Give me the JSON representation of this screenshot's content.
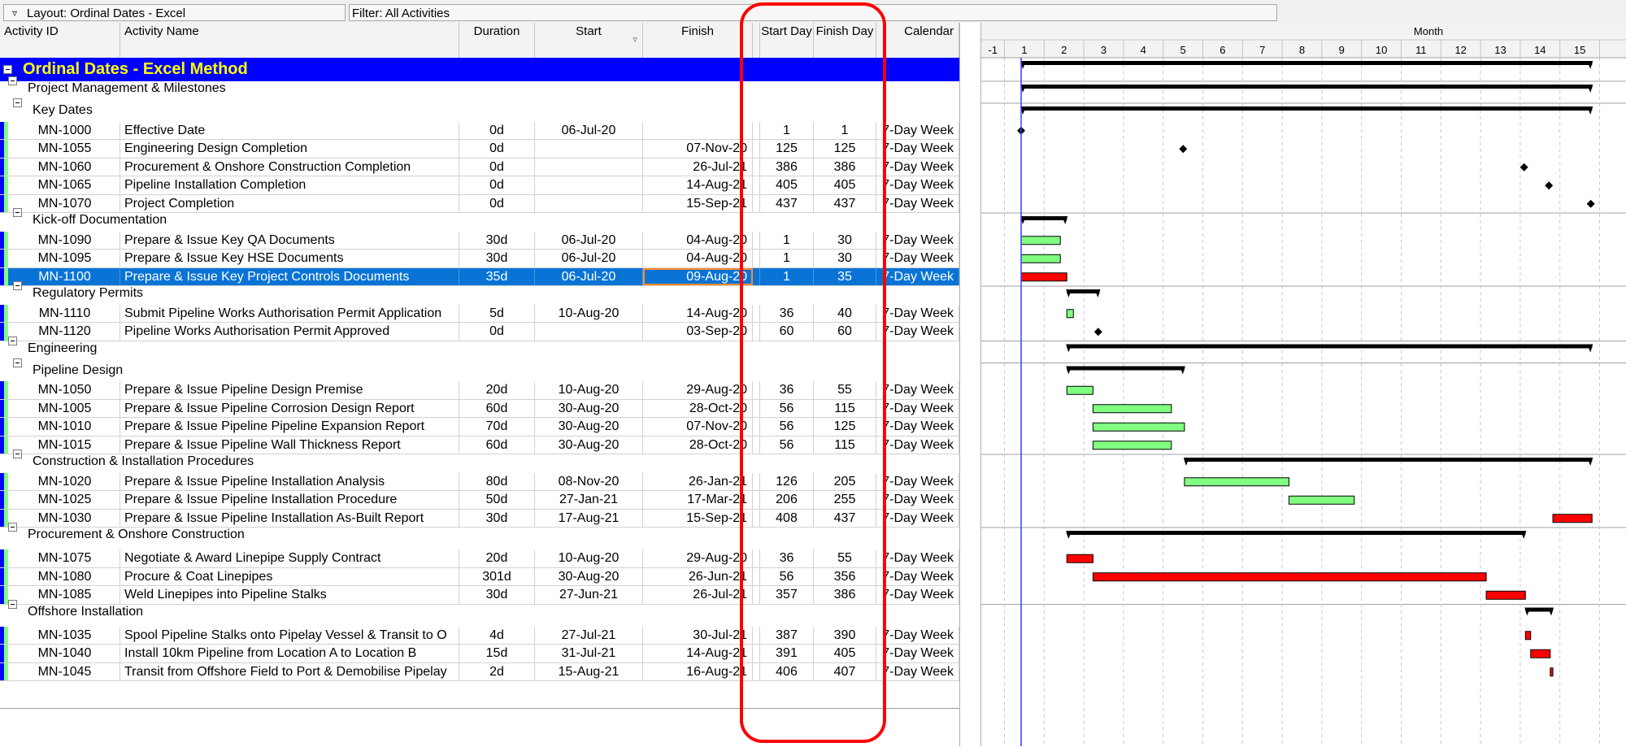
{
  "toolbar": {
    "layout_label": "Layout: Ordinal Dates - Excel",
    "filter_label": "Filter: All Activities"
  },
  "columns": {
    "activity_id": "Activity ID",
    "activity_name": "Activity Name",
    "duration": "Duration",
    "start": "Start",
    "finish": "Finish",
    "start_day": "Start Day",
    "finish_day": "Finish Day",
    "calendar": "Calendar"
  },
  "timescale": {
    "band_label": "Month",
    "months": [
      "-1",
      "1",
      "2",
      "3",
      "4",
      "5",
      "6",
      "7",
      "8",
      "9",
      "10",
      "11",
      "12",
      "13",
      "14",
      "15"
    ]
  },
  "colors": {
    "project_band": "#0000ff",
    "wbs1_band": "#80ff80",
    "wbs2_band": "#ffff00",
    "selected_row": "#0a74d6",
    "bar_normal": "#80ff80",
    "bar_critical": "#ff0000",
    "summary_bar": "#000000",
    "data_date_line": "#3a3aff",
    "callout": "#ff0000"
  },
  "rows": [
    {
      "kind": "project",
      "title": "Ordinal Dates - Excel Method",
      "summary": {
        "from": 1,
        "to": 437
      }
    },
    {
      "kind": "wbs1",
      "title": "Project Management & Milestones",
      "summary": {
        "from": 1,
        "to": 437
      }
    },
    {
      "kind": "wbs2",
      "title": "Key Dates",
      "summary": {
        "from": 1,
        "to": 437
      }
    },
    {
      "kind": "act",
      "id": "MN-1000",
      "name": "Effective Date",
      "duration": "0d",
      "start": "06-Jul-20",
      "finish": "",
      "start_day": "1",
      "finish_day": "1",
      "calendar": "7-Day Week",
      "bar": {
        "type": "milestone",
        "from": 1,
        "to": 1
      }
    },
    {
      "kind": "act",
      "id": "MN-1055",
      "name": "Engineering Design Completion",
      "duration": "0d",
      "start": "",
      "finish": "07-Nov-20",
      "start_day": "125",
      "finish_day": "125",
      "calendar": "7-Day Week",
      "bar": {
        "type": "milestone",
        "from": 125,
        "to": 125
      }
    },
    {
      "kind": "act",
      "id": "MN-1060",
      "name": "Procurement & Onshore Construction Completion",
      "duration": "0d",
      "start": "",
      "finish": "26-Jul-21",
      "start_day": "386",
      "finish_day": "386",
      "calendar": "7-Day Week",
      "bar": {
        "type": "milestone",
        "from": 386,
        "to": 386
      }
    },
    {
      "kind": "act",
      "id": "MN-1065",
      "name": "Pipeline Installation Completion",
      "duration": "0d",
      "start": "",
      "finish": "14-Aug-21",
      "start_day": "405",
      "finish_day": "405",
      "calendar": "7-Day Week",
      "bar": {
        "type": "milestone",
        "from": 405,
        "to": 405
      }
    },
    {
      "kind": "act",
      "id": "MN-1070",
      "name": "Project Completion",
      "duration": "0d",
      "start": "",
      "finish": "15-Sep-21",
      "start_day": "437",
      "finish_day": "437",
      "calendar": "7-Day Week",
      "bar": {
        "type": "milestone",
        "from": 437,
        "to": 437
      }
    },
    {
      "kind": "wbs2",
      "title": "Kick-off Documentation",
      "summary": {
        "from": 1,
        "to": 35
      }
    },
    {
      "kind": "act",
      "id": "MN-1090",
      "name": "Prepare & Issue Key QA Documents",
      "duration": "30d",
      "start": "06-Jul-20",
      "finish": "04-Aug-20",
      "start_day": "1",
      "finish_day": "30",
      "calendar": "7-Day Week",
      "bar": {
        "type": "normal",
        "from": 1,
        "to": 30
      }
    },
    {
      "kind": "act",
      "id": "MN-1095",
      "name": "Prepare & Issue Key HSE Documents",
      "duration": "30d",
      "start": "06-Jul-20",
      "finish": "04-Aug-20",
      "start_day": "1",
      "finish_day": "30",
      "calendar": "7-Day Week",
      "bar": {
        "type": "normal",
        "from": 1,
        "to": 30
      }
    },
    {
      "kind": "act",
      "id": "MN-1100",
      "name": "Prepare & Issue Key Project Controls Documents",
      "duration": "35d",
      "start": "06-Jul-20",
      "finish": "09-Aug-20",
      "start_day": "1",
      "finish_day": "35",
      "calendar": "7-Day Week",
      "selected": true,
      "bar": {
        "type": "critical",
        "from": 1,
        "to": 35
      }
    },
    {
      "kind": "wbs2",
      "title": "Regulatory Permits",
      "summary": {
        "from": 36,
        "to": 60
      }
    },
    {
      "kind": "act",
      "id": "MN-1110",
      "name": "Submit Pipeline Works Authorisation Permit Application",
      "duration": "5d",
      "start": "10-Aug-20",
      "finish": "14-Aug-20",
      "start_day": "36",
      "finish_day": "40",
      "calendar": "7-Day Week",
      "bar": {
        "type": "normal",
        "from": 36,
        "to": 40
      }
    },
    {
      "kind": "act",
      "id": "MN-1120",
      "name": "Pipeline Works Authorisation Permit Approved",
      "duration": "0d",
      "start": "",
      "finish": "03-Sep-20",
      "start_day": "60",
      "finish_day": "60",
      "calendar": "7-Day Week",
      "bar": {
        "type": "milestone",
        "from": 60,
        "to": 60
      }
    },
    {
      "kind": "wbs1",
      "title": "Engineering",
      "summary": {
        "from": 36,
        "to": 437
      }
    },
    {
      "kind": "wbs2",
      "title": "Pipeline Design",
      "summary": {
        "from": 36,
        "to": 125
      }
    },
    {
      "kind": "act",
      "id": "MN-1050",
      "name": "Prepare & Issue Pipeline Design Premise",
      "duration": "20d",
      "start": "10-Aug-20",
      "finish": "29-Aug-20",
      "start_day": "36",
      "finish_day": "55",
      "calendar": "7-Day Week",
      "bar": {
        "type": "normal",
        "from": 36,
        "to": 55
      }
    },
    {
      "kind": "act",
      "id": "MN-1005",
      "name": "Prepare & Issue Pipeline Corrosion Design Report",
      "duration": "60d",
      "start": "30-Aug-20",
      "finish": "28-Oct-20",
      "start_day": "56",
      "finish_day": "115",
      "calendar": "7-Day Week",
      "bar": {
        "type": "normal",
        "from": 56,
        "to": 115
      }
    },
    {
      "kind": "act",
      "id": "MN-1010",
      "name": "Prepare & Issue Pipeline Pipeline Expansion Report",
      "duration": "70d",
      "start": "30-Aug-20",
      "finish": "07-Nov-20",
      "start_day": "56",
      "finish_day": "125",
      "calendar": "7-Day Week",
      "bar": {
        "type": "normal",
        "from": 56,
        "to": 125
      }
    },
    {
      "kind": "act",
      "id": "MN-1015",
      "name": "Prepare & Issue Pipeline Wall Thickness Report",
      "duration": "60d",
      "start": "30-Aug-20",
      "finish": "28-Oct-20",
      "start_day": "56",
      "finish_day": "115",
      "calendar": "7-Day Week",
      "bar": {
        "type": "normal",
        "from": 56,
        "to": 115
      }
    },
    {
      "kind": "wbs2",
      "title": "Construction & Installation Procedures",
      "summary": {
        "from": 126,
        "to": 437
      }
    },
    {
      "kind": "act",
      "id": "MN-1020",
      "name": "Prepare & Issue Pipeline Installation Analysis",
      "duration": "80d",
      "start": "08-Nov-20",
      "finish": "26-Jan-21",
      "start_day": "126",
      "finish_day": "205",
      "calendar": "7-Day Week",
      "bar": {
        "type": "normal",
        "from": 126,
        "to": 205
      }
    },
    {
      "kind": "act",
      "id": "MN-1025",
      "name": "Prepare & Issue Pipeline Installation Procedure",
      "duration": "50d",
      "start": "27-Jan-21",
      "finish": "17-Mar-21",
      "start_day": "206",
      "finish_day": "255",
      "calendar": "7-Day Week",
      "bar": {
        "type": "normal",
        "from": 206,
        "to": 255
      }
    },
    {
      "kind": "act",
      "id": "MN-1030",
      "name": "Prepare & Issue Pipeline Installation As-Built Report",
      "duration": "30d",
      "start": "17-Aug-21",
      "finish": "15-Sep-21",
      "start_day": "408",
      "finish_day": "437",
      "calendar": "7-Day Week",
      "bar": {
        "type": "critical",
        "from": 408,
        "to": 437
      }
    },
    {
      "kind": "wbs1",
      "title": "Procurement & Onshore Construction",
      "summary": {
        "from": 36,
        "to": 386
      }
    },
    {
      "kind": "act",
      "id": "MN-1075",
      "name": "Negotiate & Award Linepipe Supply Contract",
      "duration": "20d",
      "start": "10-Aug-20",
      "finish": "29-Aug-20",
      "start_day": "36",
      "finish_day": "55",
      "calendar": "7-Day Week",
      "bar": {
        "type": "critical",
        "from": 36,
        "to": 55
      }
    },
    {
      "kind": "act",
      "id": "MN-1080",
      "name": "Procure & Coat Linepipes",
      "duration": "301d",
      "start": "30-Aug-20",
      "finish": "26-Jun-21",
      "start_day": "56",
      "finish_day": "356",
      "calendar": "7-Day Week",
      "bar": {
        "type": "critical",
        "from": 56,
        "to": 356
      }
    },
    {
      "kind": "act",
      "id": "MN-1085",
      "name": "Weld Linepipes into Pipeline Stalks",
      "duration": "30d",
      "start": "27-Jun-21",
      "finish": "26-Jul-21",
      "start_day": "357",
      "finish_day": "386",
      "calendar": "7-Day Week",
      "bar": {
        "type": "critical",
        "from": 357,
        "to": 386
      }
    },
    {
      "kind": "wbs1",
      "title": "Offshore Installation",
      "summary": {
        "from": 387,
        "to": 407
      }
    },
    {
      "kind": "act",
      "id": "MN-1035",
      "name": "Spool Pipeline Stalks onto Pipelay Vessel & Transit to O",
      "duration": "4d",
      "start": "27-Jul-21",
      "finish": "30-Jul-21",
      "start_day": "387",
      "finish_day": "390",
      "calendar": "7-Day Week",
      "bar": {
        "type": "critical",
        "from": 387,
        "to": 390
      }
    },
    {
      "kind": "act",
      "id": "MN-1040",
      "name": "Install 10km Pipeline from Location A to Location B",
      "duration": "15d",
      "start": "31-Jul-21",
      "finish": "14-Aug-21",
      "start_day": "391",
      "finish_day": "405",
      "calendar": "7-Day Week",
      "bar": {
        "type": "critical",
        "from": 391,
        "to": 405
      }
    },
    {
      "kind": "act",
      "id": "MN-1045",
      "name": "Transit from Offshore Field to Port & Demobilise Pipelay",
      "duration": "2d",
      "start": "15-Aug-21",
      "finish": "16-Aug-21",
      "start_day": "406",
      "finish_day": "407",
      "calendar": "7-Day Week",
      "bar": {
        "type": "critical",
        "from": 406,
        "to": 407
      }
    }
  ]
}
